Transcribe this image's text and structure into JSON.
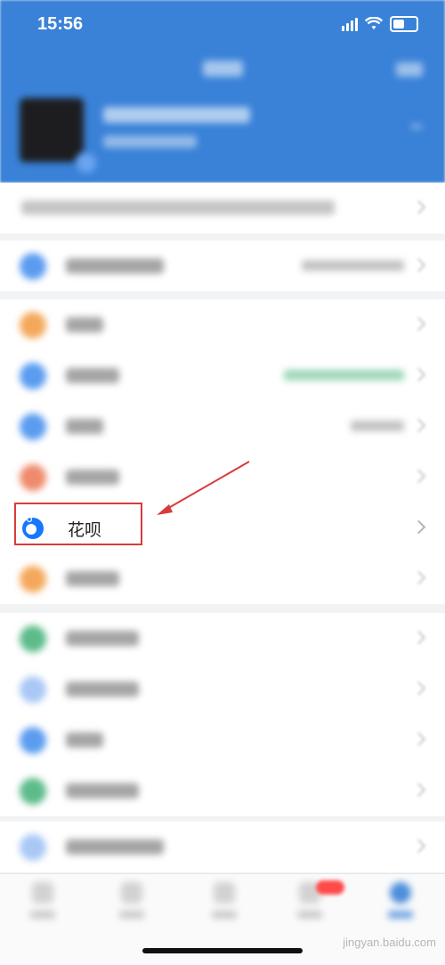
{
  "status_bar": {
    "time": "15:56"
  },
  "menu": {
    "huabei_label": "花呗"
  },
  "colors": {
    "brand_blue": "#3a82d8",
    "highlight_red": "#d83b3b",
    "orange": "#f4a85b",
    "blue": "#5b9cf0",
    "red_orange": "#ef8a6d",
    "green": "#5dbb8a",
    "light_blue": "#a9c8f5"
  },
  "icons": {
    "huabei": "huabei-logo-icon",
    "chevron": "chevron-right-icon",
    "wifi": "wifi-icon",
    "battery": "battery-icon",
    "signal": "signal-icon"
  },
  "watermark": "jingyan.baidu.com"
}
